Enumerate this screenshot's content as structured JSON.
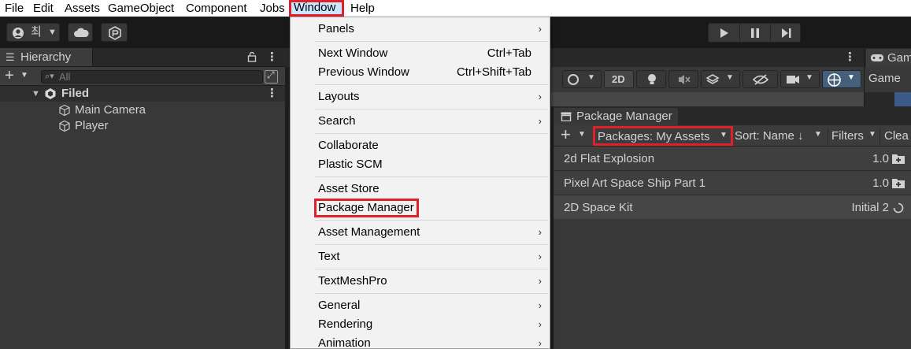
{
  "menubar": {
    "items": [
      "File",
      "Edit",
      "Assets",
      "GameObject",
      "Component",
      "Jobs",
      "Window",
      "Help"
    ],
    "active": "Window"
  },
  "toolbar": {
    "account_initial": "최"
  },
  "hierarchy": {
    "tab_title": "Hierarchy",
    "search_placeholder": "All",
    "scene_name": "Filed",
    "objects": [
      "Main Camera",
      "Player"
    ]
  },
  "scene_toolbar": {
    "mode_2d_label": "2D"
  },
  "game_pane": {
    "tab_title": "Gam",
    "dropdown_label": "Game"
  },
  "package_manager": {
    "tab_title": "Package Manager",
    "packages_dropdown": "Packages: My Assets",
    "sort_label": "Sort: Name ↓",
    "filters_label": "Filters",
    "clear_label": "Clea",
    "rows": [
      {
        "name": "2d Flat Explosion",
        "version": "1.0",
        "status": "download"
      },
      {
        "name": "Pixel Art Space Ship Part 1",
        "version": "1.0",
        "status": "download"
      },
      {
        "name": "2D Space Kit",
        "version": "Initial 2",
        "status": "loading"
      }
    ]
  },
  "window_menu": {
    "items": [
      {
        "label": "Panels",
        "shortcut": "",
        "submenu": true
      },
      {
        "label": "Next Window",
        "shortcut": "Ctrl+Tab",
        "submenu": false
      },
      {
        "label": "Previous Window",
        "shortcut": "Ctrl+Shift+Tab",
        "submenu": false
      },
      {
        "label": "Layouts",
        "shortcut": "",
        "submenu": true
      },
      {
        "label": "Search",
        "shortcut": "",
        "submenu": true
      },
      {
        "label": "Collaborate",
        "shortcut": "",
        "submenu": false
      },
      {
        "label": "Plastic SCM",
        "shortcut": "",
        "submenu": false
      },
      {
        "label": "Asset Store",
        "shortcut": "",
        "submenu": false
      },
      {
        "label": "Package Manager",
        "shortcut": "",
        "submenu": false,
        "highlighted": true
      },
      {
        "label": "Asset Management",
        "shortcut": "",
        "submenu": true
      },
      {
        "label": "Text",
        "shortcut": "",
        "submenu": true
      },
      {
        "label": "TextMeshPro",
        "shortcut": "",
        "submenu": true
      },
      {
        "label": "General",
        "shortcut": "",
        "submenu": true
      },
      {
        "label": "Rendering",
        "shortcut": "",
        "submenu": true
      },
      {
        "label": "Animation",
        "shortcut": "",
        "submenu": true
      }
    ],
    "submenu_arrow": "›"
  },
  "colors": {
    "highlight_box": "#e0202a",
    "menu_bg": "#f2f2f2",
    "editor_dark": "#383838"
  }
}
